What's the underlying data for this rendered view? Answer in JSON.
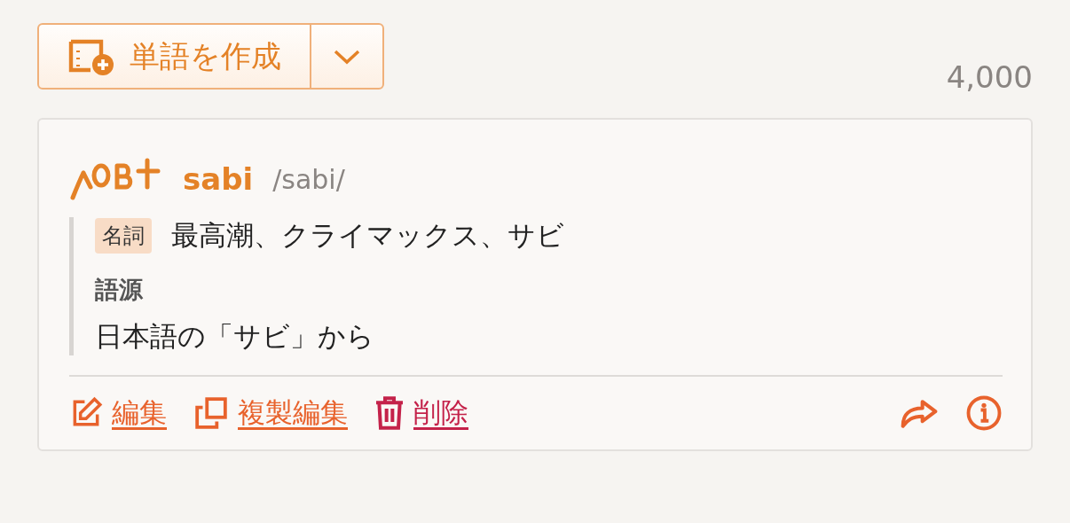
{
  "create_button": {
    "label": "単語を作成"
  },
  "count": "4,000",
  "entry": {
    "word": "sabi",
    "pronunciation": "/sabi/",
    "translations": [
      {
        "part_of_speech": "名詞",
        "meaning": "最高潮、クライマックス、サビ"
      }
    ],
    "contents": [
      {
        "title": "語源",
        "text": "日本語の「サビ」から"
      }
    ],
    "actions": [
      {
        "kind": "edit",
        "label": "編集"
      },
      {
        "kind": "copy",
        "label": "複製編集"
      },
      {
        "kind": "delete",
        "label": "削除"
      }
    ]
  }
}
